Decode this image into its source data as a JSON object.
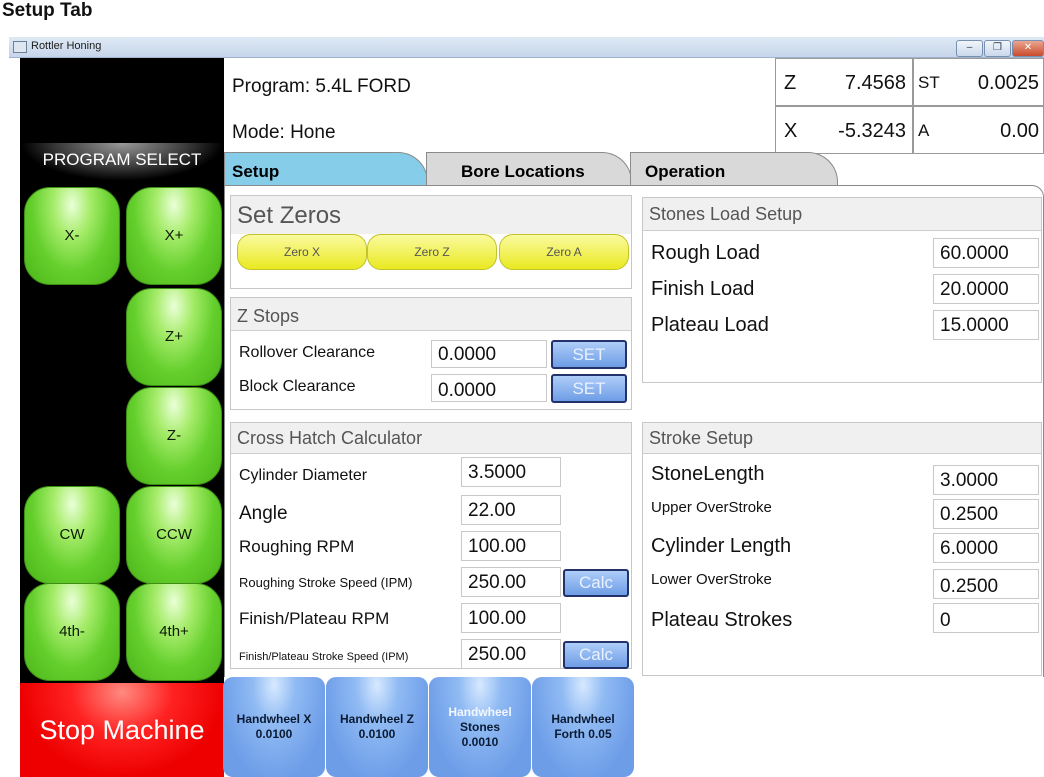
{
  "page_heading": "Setup Tab",
  "window": {
    "title": "Rottler Honing",
    "min_glyph": "–",
    "max_glyph": "❐",
    "close_glyph": "✕"
  },
  "sidebar": {
    "program_select": "PROGRAM SELECT",
    "jog_buttons": {
      "x_minus": "X-",
      "x_plus": "X+",
      "z_plus": "Z+",
      "z_minus": "Z-",
      "cw": "CW",
      "ccw": "CCW",
      "fourth_minus": "4th-",
      "fourth_plus": "4th+"
    },
    "stop": "Stop Machine"
  },
  "header": {
    "program": "Program: 5.4L FORD",
    "mode": "Mode: Hone"
  },
  "readouts": {
    "z": {
      "label": "Z",
      "value": "7.4568"
    },
    "st": {
      "label": "ST",
      "value": "0.0025"
    },
    "x": {
      "label": "X",
      "value": "-5.3243"
    },
    "a": {
      "label": "A",
      "value": "0.00"
    }
  },
  "tabs": {
    "setup": "Setup",
    "bore_locations": "Bore Locations",
    "operation": "Operation"
  },
  "set_zeros": {
    "title": "Set Zeros",
    "zero_x": "Zero X",
    "zero_z": "Zero Z",
    "zero_a": "Zero A"
  },
  "z_stops": {
    "title": "Z Stops",
    "rollover_label": "Rollover Clearance",
    "rollover_value": "0.0000",
    "block_label": "Block Clearance",
    "block_value": "0.0000",
    "set_label": "SET"
  },
  "cross_hatch": {
    "title": "Cross Hatch Calculator",
    "cyl_diam_label": "Cylinder Diameter",
    "cyl_diam_value": "3.5000",
    "angle_label": "Angle",
    "angle_value": "22.00",
    "rough_rpm_label": "Roughing RPM",
    "rough_rpm_value": "100.00",
    "rough_speed_label": "Roughing Stroke Speed (IPM)",
    "rough_speed_value": "250.00",
    "finish_rpm_label": "Finish/Plateau RPM",
    "finish_rpm_value": "100.00",
    "finish_speed_label": "Finish/Plateau Stroke Speed (IPM)",
    "finish_speed_value": "250.00",
    "calc_label": "Calc"
  },
  "stones_load": {
    "title": "Stones Load Setup",
    "rough_label": "Rough Load",
    "rough_value": "60.0000",
    "finish_label": "Finish Load",
    "finish_value": "20.0000",
    "plateau_label": "Plateau Load",
    "plateau_value": "15.0000"
  },
  "stroke_setup": {
    "title": "Stroke Setup",
    "stone_len_label": "StoneLength",
    "stone_len_value": "3.0000",
    "upper_label": "Upper OverStroke",
    "upper_value": "0.2500",
    "cyl_len_label": "Cylinder Length",
    "cyl_len_value": "6.0000",
    "lower_label": "Lower OverStroke",
    "lower_value": "0.2500",
    "plateau_strokes_label": "Plateau Strokes",
    "plateau_strokes_value": "0"
  },
  "handwheels": [
    {
      "line1": "Handwheel X",
      "line2": "0.0100",
      "line3": ""
    },
    {
      "line1": "Handwheel Z",
      "line2": "0.0100",
      "line3": ""
    },
    {
      "line1": "Handwheel",
      "line2": "Stones",
      "line3": "0.0010"
    },
    {
      "line1": "Handwheel",
      "line2": "Forth 0.05",
      "line3": ""
    }
  ]
}
